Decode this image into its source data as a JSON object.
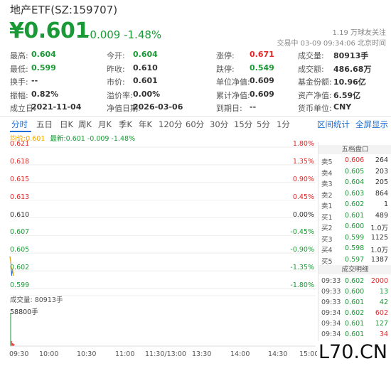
{
  "header": {
    "title": "地产ETF(SZ:159707)",
    "price": "¥0.601",
    "change": "-0.009 -1.48%",
    "follow": "1.19 万球友关注",
    "status": "交易中 03-09 09:34:06 北京时间"
  },
  "quote": {
    "rows": [
      [
        {
          "label": "最高:",
          "value": "0.604",
          "color": "green"
        },
        {
          "label": "今开:",
          "value": "0.604",
          "color": "green"
        },
        {
          "label": "涨停:",
          "value": "0.671",
          "color": "red"
        },
        {
          "label": "成交量:",
          "value": "80913手",
          "color": "default"
        }
      ],
      [
        {
          "label": "最低:",
          "value": "0.599",
          "color": "green"
        },
        {
          "label": "昨收:",
          "value": "0.610",
          "color": "default"
        },
        {
          "label": "跌停:",
          "value": "0.549",
          "color": "green"
        },
        {
          "label": "成交额:",
          "value": "486.68万",
          "color": "default"
        }
      ],
      [
        {
          "label": "换手:",
          "value": "--",
          "color": "default"
        },
        {
          "label": "市价:",
          "value": "0.601",
          "color": "default"
        },
        {
          "label": "单位净值:",
          "value": "0.609",
          "color": "default"
        },
        {
          "label": "基金份额:",
          "value": "10.96亿",
          "color": "default"
        }
      ],
      [
        {
          "label": "振幅:",
          "value": "0.82%",
          "color": "default"
        },
        {
          "label": "溢价率:",
          "value": "0.00%",
          "color": "default"
        },
        {
          "label": "累计净值:",
          "value": "0.609",
          "color": "default"
        },
        {
          "label": "资产净值:",
          "value": "6.59亿",
          "color": "default"
        }
      ],
      [
        {
          "label": "成立日:",
          "value": "2021-11-04",
          "color": "default"
        },
        {
          "label": "净值日期:",
          "value": "2026-03-06",
          "color": "default"
        },
        {
          "label": "到期日:",
          "value": "--",
          "color": "default"
        },
        {
          "label": "货币单位:",
          "value": "CNY",
          "color": "default"
        }
      ]
    ]
  },
  "tabs": [
    "分时",
    "五日",
    "日K",
    "周K",
    "月K",
    "季K",
    "年K",
    "120分",
    "60分",
    "30分",
    "15分",
    "5分",
    "1分"
  ],
  "active_tab": "分时",
  "links": {
    "stats": "区间统计",
    "fullscreen": "全屏显示"
  },
  "legend": {
    "avg": "均价:0.601",
    "latest": "最新:0.601 -0.009 -1.48%"
  },
  "chart_data": {
    "type": "line",
    "y_prices": [
      "0.621",
      "0.618",
      "0.615",
      "0.613",
      "0.610",
      "0.607",
      "0.605",
      "0.602",
      "0.599"
    ],
    "y_percents": [
      "1.80%",
      "1.35%",
      "0.90%",
      "0.45%",
      "0.00%",
      "-0.45%",
      "-0.90%",
      "-1.35%",
      "-1.80%"
    ],
    "price_range": [
      0.599,
      0.621
    ],
    "prev_close": 0.61,
    "x_ticks": [
      "09:30",
      "10:00",
      "10:30",
      "11:00",
      "11:30/13:00",
      "13:30",
      "14:00",
      "14:30",
      "15:00"
    ],
    "series": [
      {
        "name": "最新",
        "values": [
          0.604,
          0.603,
          0.601,
          0.602,
          0.601
        ]
      },
      {
        "name": "均价",
        "values": [
          0.604,
          0.603,
          0.602,
          0.602,
          0.601
        ]
      }
    ],
    "volume": {
      "label": "成交量: 80913手",
      "max_label": "58800手",
      "values": [
        58800,
        9000,
        5000,
        4500,
        3600
      ]
    }
  },
  "orderbook": {
    "title": "五档盘口",
    "asks": [
      {
        "label": "卖5",
        "price": "0.606",
        "vol": "264",
        "color": "red"
      },
      {
        "label": "卖4",
        "price": "0.605",
        "vol": "203",
        "color": "green"
      },
      {
        "label": "卖3",
        "price": "0.604",
        "vol": "205",
        "color": "green"
      },
      {
        "label": "卖2",
        "price": "0.603",
        "vol": "864",
        "color": "green"
      },
      {
        "label": "卖1",
        "price": "0.602",
        "vol": "1",
        "color": "green"
      }
    ],
    "bids": [
      {
        "label": "买1",
        "price": "0.601",
        "vol": "489",
        "color": "green"
      },
      {
        "label": "买2",
        "price": "0.600",
        "vol": "1.0万",
        "color": "green"
      },
      {
        "label": "买3",
        "price": "0.599",
        "vol": "1125",
        "color": "green"
      },
      {
        "label": "买4",
        "price": "0.598",
        "vol": "1.0万",
        "color": "green"
      },
      {
        "label": "买5",
        "price": "0.597",
        "vol": "1387",
        "color": "green"
      }
    ],
    "trades_title": "成交明细",
    "trades": [
      {
        "time": "09:33",
        "price": "0.602",
        "vol": "2000",
        "color": "red"
      },
      {
        "time": "09:33",
        "price": "0.600",
        "vol": "13",
        "color": "green"
      },
      {
        "time": "09:33",
        "price": "0.601",
        "vol": "42",
        "color": "green"
      },
      {
        "time": "09:34",
        "price": "0.602",
        "vol": "602",
        "color": "red"
      },
      {
        "time": "09:34",
        "price": "0.601",
        "vol": "127",
        "color": "green"
      },
      {
        "time": "09:34",
        "price": "0.601",
        "vol": "34",
        "color": "red"
      },
      {
        "time": "09:34",
        "price": "0.601",
        "vol": "146",
        "color": "red"
      }
    ]
  },
  "watermark": "L70.CN",
  "colors": {
    "up": "#e02a2a",
    "down": "#1a9a36",
    "accent": "#1e6fd6",
    "avg": "#f0a400"
  }
}
